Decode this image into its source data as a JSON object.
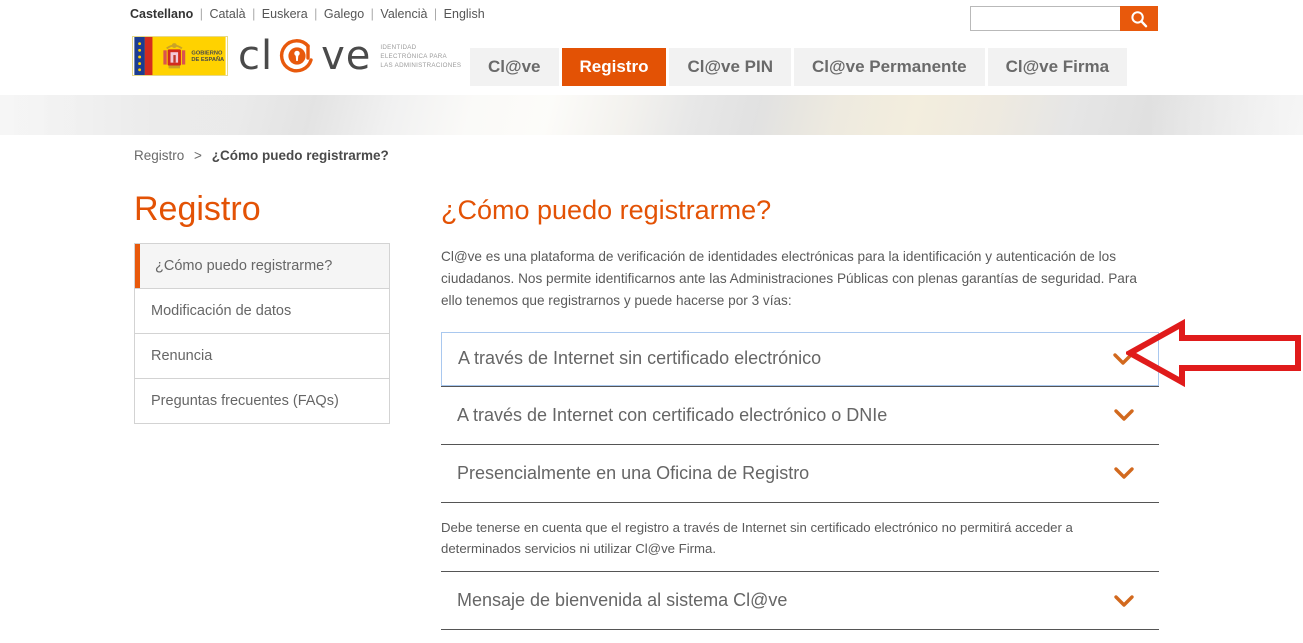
{
  "languages": [
    {
      "label": "Castellano",
      "active": true
    },
    {
      "label": "Català",
      "active": false
    },
    {
      "label": "Euskera",
      "active": false
    },
    {
      "label": "Galego",
      "active": false
    },
    {
      "label": "Valencià",
      "active": false
    },
    {
      "label": "English",
      "active": false
    }
  ],
  "search": {
    "value": "",
    "placeholder": "",
    "icon": "search-icon"
  },
  "brand": {
    "government_text_line1": "GOBIERNO",
    "government_text_line2": "DE ESPAÑA",
    "wordmark": "cl@ve",
    "wordmark_part1": "cl",
    "wordmark_part2": "ve",
    "tagline_line1": "IDENTIDAD",
    "tagline_line2": "ELECTRÓNICA PARA",
    "tagline_line3": "LAS ADMINISTRACIONES"
  },
  "nav": {
    "tabs": [
      {
        "label": "Cl@ve",
        "active": false
      },
      {
        "label": "Registro",
        "active": true
      },
      {
        "label": "Cl@ve PIN",
        "active": false
      },
      {
        "label": "Cl@ve Permanente",
        "active": false
      },
      {
        "label": "Cl@ve Firma",
        "active": false
      }
    ]
  },
  "breadcrumb": {
    "parent": "Registro",
    "separator": ">",
    "current": "¿Cómo puedo registrarme?"
  },
  "sidebar": {
    "title": "Registro",
    "items": [
      {
        "label": "¿Cómo puedo registrarme?",
        "active": true
      },
      {
        "label": "Modificación de datos",
        "active": false
      },
      {
        "label": "Renuncia",
        "active": false
      },
      {
        "label": "Preguntas frecuentes (FAQs)",
        "active": false
      }
    ]
  },
  "main": {
    "title": "¿Cómo puedo registrarme?",
    "intro": "Cl@ve es una plataforma de verificación de identidades electrónicas para la identificación y autenticación de los ciudadanos. Nos permite identificarnos ante las Administraciones Públicas con plenas garantías de seguridad. Para ello tenemos que registrarnos y puede hacerse por 3 vías:",
    "accordion": [
      {
        "label": "A través de Internet sin certificado electrónico",
        "expanded": false,
        "focused": true
      },
      {
        "label": "A través de Internet con certificado electrónico o DNIe",
        "expanded": false,
        "focused": false
      },
      {
        "label": "Presencialmente en una Oficina de Registro",
        "expanded": false,
        "focused": false
      }
    ],
    "note": "Debe tenerse en cuenta que el registro a través de Internet sin certificado electrónico no permitirá acceder a determinados servicios ni utilizar Cl@ve Firma.",
    "accordion_last": [
      {
        "label": "Mensaje de bienvenida al sistema Cl@ve",
        "expanded": false,
        "focused": false
      }
    ]
  },
  "annotation": {
    "type": "left-arrow",
    "color": "#E01B1B"
  },
  "colors": {
    "accent_orange": "#E35205",
    "button_orange": "#E8590C",
    "chevron_orange": "#D2691E",
    "focus_blue": "#a9c8ef",
    "text_gray": "#666666",
    "divider": "#555555"
  }
}
